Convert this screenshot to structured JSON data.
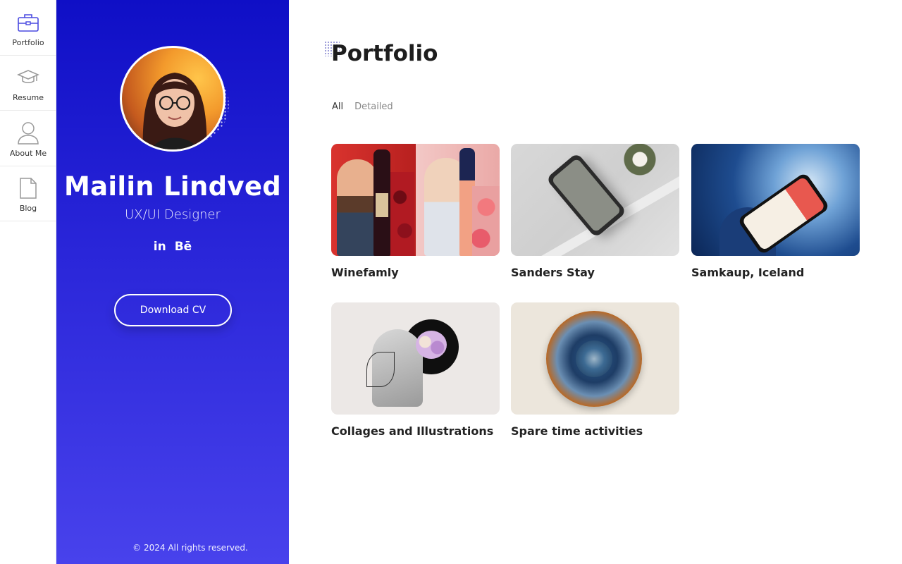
{
  "nav": {
    "items": [
      {
        "label": "Portfolio",
        "icon": "briefcase-icon",
        "active": true
      },
      {
        "label": "Resume",
        "icon": "graduation-cap-icon",
        "active": false
      },
      {
        "label": "About Me",
        "icon": "user-icon",
        "active": false
      },
      {
        "label": "Blog",
        "icon": "document-icon",
        "active": false
      }
    ]
  },
  "profile": {
    "name": "Mailin Lindved",
    "role": "UX/UI Designer",
    "socials": [
      "in",
      "Bē"
    ],
    "cv_button": "Download CV",
    "copyright": "© 2024 All rights reserved."
  },
  "main": {
    "title": "Portfolio",
    "filters": [
      "All",
      "Detailed"
    ],
    "active_filter": "All",
    "projects": [
      {
        "title": "Winefamly"
      },
      {
        "title": "Sanders Stay"
      },
      {
        "title": "Samkaup, Iceland"
      },
      {
        "title": "Collages and Illustrations"
      },
      {
        "title": "Spare time activities"
      }
    ]
  },
  "colors": {
    "accent": "#4a4ae0",
    "panel_top": "#0f0fc6",
    "panel_bottom": "#4842ec"
  }
}
